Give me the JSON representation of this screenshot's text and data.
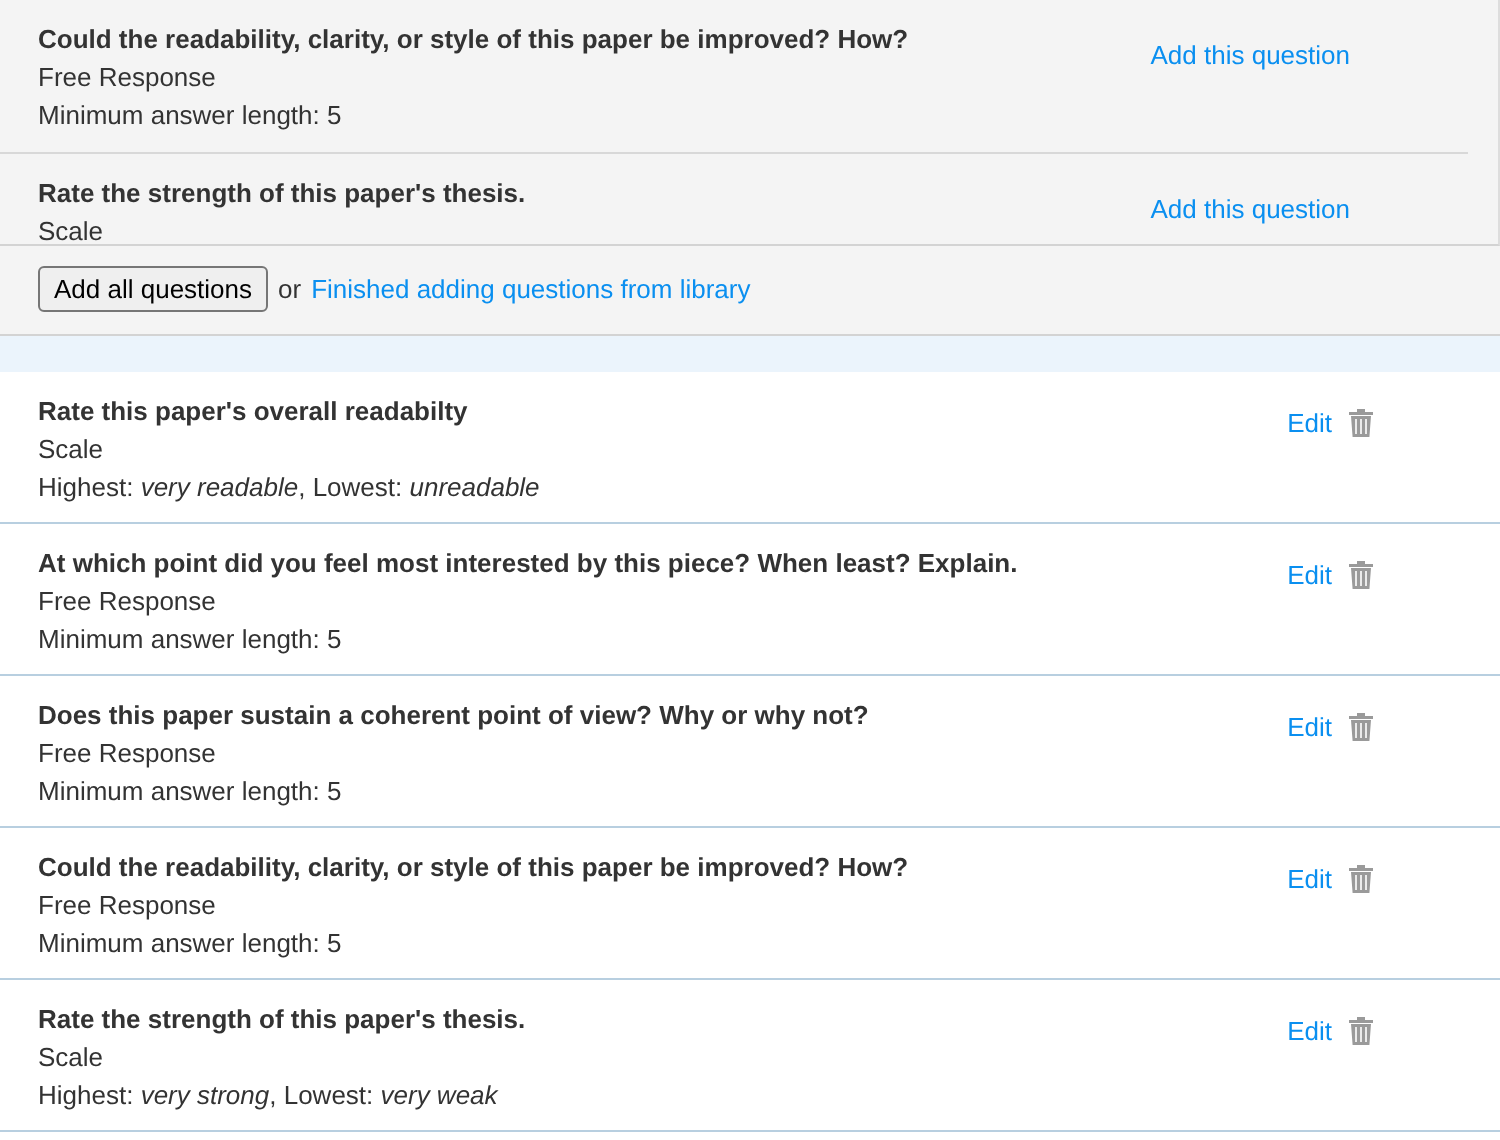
{
  "library": {
    "items": [
      {
        "title": "Could the readability, clarity, or style of this paper be improved? How?",
        "type": "Free Response",
        "detail": "Minimum answer length: 5",
        "action": "Add this question"
      },
      {
        "title": "Rate the strength of this paper's thesis.",
        "type": "Scale",
        "action": "Add this question"
      }
    ],
    "add_all_button": "Add all questions",
    "separator": "or",
    "finished_link": "Finished adding questions from library"
  },
  "questions": [
    {
      "title": "Rate this paper's overall readabilty",
      "type": "Scale",
      "detail": "Highest: *very readable*, Lowest: *unreadable*",
      "edit": "Edit"
    },
    {
      "title": "At which point did you feel most interested by this piece? When least? Explain.",
      "type": "Free Response",
      "detail": "Minimum answer length: 5",
      "edit": "Edit"
    },
    {
      "title": "Does this paper sustain a coherent point of view? Why or why not?",
      "type": "Free Response",
      "detail": "Minimum answer length: 5",
      "edit": "Edit"
    },
    {
      "title": "Could the readability, clarity, or style of this paper be improved? How?",
      "type": "Free Response",
      "detail": "Minimum answer length: 5",
      "edit": "Edit"
    },
    {
      "title": "Rate the strength of this paper's thesis.",
      "type": "Scale",
      "detail": "Highest: *very strong*, Lowest: *very weak*",
      "edit": "Edit"
    }
  ]
}
